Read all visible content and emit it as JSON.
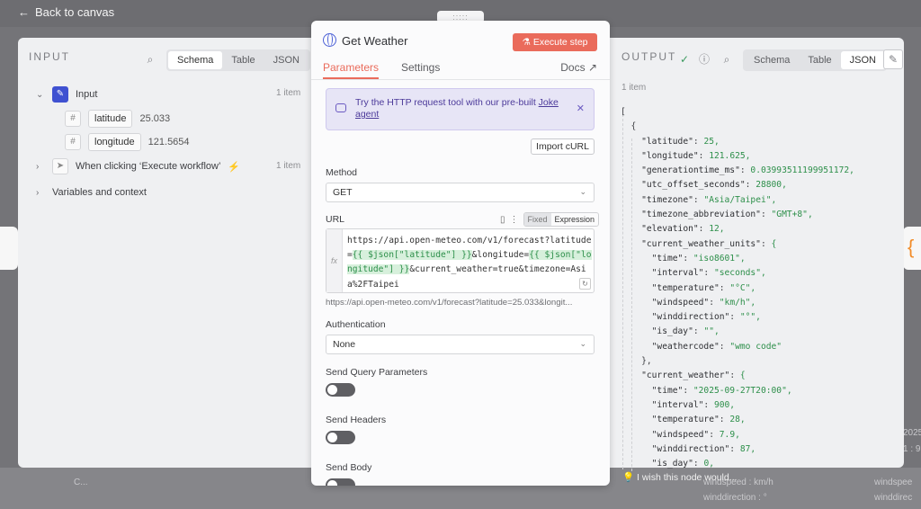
{
  "topbar": {
    "back_label": "Back to canvas"
  },
  "input_panel": {
    "heading": "INPUT",
    "view_tabs": [
      "Schema",
      "Table",
      "JSON"
    ],
    "active_view": "Schema",
    "tree": [
      {
        "label": "Input",
        "count": "1 item",
        "fields": [
          {
            "name": "latitude",
            "value": "25.033"
          },
          {
            "name": "longitude",
            "value": "121.5654"
          }
        ]
      },
      {
        "label": "When clicking ‘Execute workflow’",
        "count": "1 item"
      },
      {
        "label": "Variables and context"
      }
    ]
  },
  "modal": {
    "title": "Get Weather",
    "execute_label": "Execute step",
    "tabs": [
      "Parameters",
      "Settings"
    ],
    "docs_label": "Docs",
    "callout": {
      "text": "Try the HTTP request tool with our pre-built ",
      "link": "Joke agent"
    },
    "import_label": "Import cURL",
    "method_label": "Method",
    "method_value": "GET",
    "url_label": "URL",
    "url_mode": [
      "Fixed",
      "Expression"
    ],
    "url_parts": [
      "https://api.open-meteo.com/v1/forecast?latitude=",
      "{{ $json[\"latitude\"] }}",
      "&longitude=",
      "{{ $json[\"longitude\"] }}",
      "&current_weather=true&timezone=Asia%2FTaipei"
    ],
    "url_preview": "https://api.open-meteo.com/v1/forecast?latitude=25.033&longit...",
    "auth_label": "Authentication",
    "auth_value": "None",
    "query_label": "Send Query Parameters",
    "headers_label": "Send Headers",
    "body_label": "Send Body"
  },
  "output_panel": {
    "heading": "OUTPUT",
    "view_tabs": [
      "Schema",
      "Table",
      "JSON"
    ],
    "active_view": "JSON",
    "item_count": "1 item",
    "json_lines": [
      "[",
      "  {",
      "    \"latitude\": 25,",
      "    \"longitude\": 121.625,",
      "    \"generationtime_ms\": 0.03993511199951172,",
      "    \"utc_offset_seconds\": 28800,",
      "    \"timezone\": \"Asia/Taipei\",",
      "    \"timezone_abbreviation\": \"GMT+8\",",
      "    \"elevation\": 12,",
      "    \"current_weather_units\": {",
      "      \"time\": \"iso8601\",",
      "      \"interval\": \"seconds\",",
      "      \"temperature\": \"°C\",",
      "      \"windspeed\": \"km/h\",",
      "      \"winddirection\": \"°\",",
      "      \"is_day\": \"\",",
      "      \"weathercode\": \"wmo code\"",
      "    },",
      "    \"current_weather\": {",
      "      \"time\": \"2025-09-27T20:00\",",
      "      \"interval\": 900,",
      "      \"temperature\": 28,",
      "      \"windspeed\": 7.9,",
      "      \"winddirection\": 87,",
      "      \"is_day\": 0,"
    ]
  },
  "footer": {
    "wish_text": "I wish this node would..."
  },
  "canvas_bg_text": [
    "C...",
    "windspeed : km/h",
    "winddirection : °",
    "windspee",
    "winddirec",
    "2025",
    "1 : 9"
  ],
  "colors": {
    "accent": "#ea6b5b",
    "expression": "#2d8f4a",
    "callout": "#e7e5f6"
  }
}
